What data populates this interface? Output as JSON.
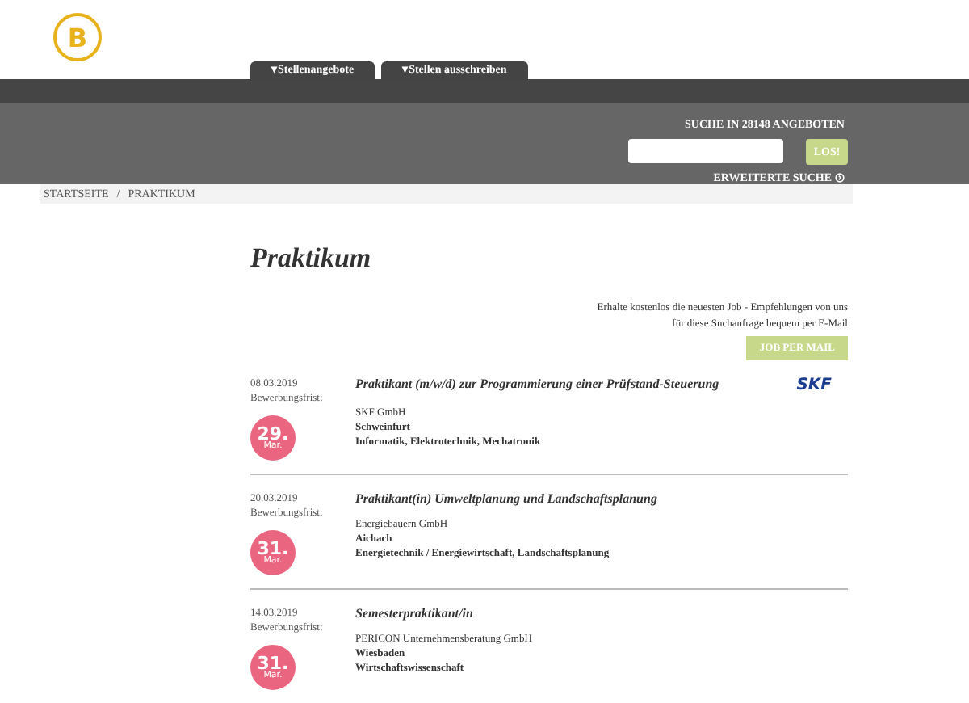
{
  "logo": {
    "letter": "B"
  },
  "nav_tabs": [
    {
      "label": "▾Stellenangebote"
    },
    {
      "label": "▾Stellen ausschreiben"
    }
  ],
  "search": {
    "label": "SUCHE IN 28148 ANGEBOTEN",
    "button": "LOS!",
    "advanced": "ERWEITERTE SUCHE"
  },
  "breadcrumb": {
    "items": [
      "STARTSEITE",
      "PRAKTIKUM"
    ],
    "separator": "/"
  },
  "page_title": "Praktikum",
  "mail_promo": {
    "text": "Erhalte kostenlos die neuesten Job - Empfehlungen von uns für diese Suchanfrage bequem per E-Mail",
    "button": "JOB PER MAIL"
  },
  "jobs": [
    {
      "date": "08.03.2019",
      "deadline_label": "Bewerbungsfrist:",
      "deadline_day": "29.",
      "deadline_month": "Mar.",
      "title": "Praktikant (m/w/d) zur Programmierung einer Prüfstand-Steuerung",
      "company": "SKF GmbH",
      "location": "Schweinfurt",
      "fields": "Informatik, Elektrotechnik, Mechatronik",
      "company_logo": "SKF"
    },
    {
      "date": "20.03.2019",
      "deadline_label": "Bewerbungsfrist:",
      "deadline_day": "31.",
      "deadline_month": "Mar.",
      "title": "Praktikant(in) Umweltplanung und Landschaftsplanung",
      "company": "Energiebauern GmbH",
      "location": "Aichach",
      "fields": "Energietechnik / Energiewirtschaft, Landschaftsplanung"
    },
    {
      "date": "14.03.2019",
      "deadline_label": "Bewerbungsfrist:",
      "deadline_day": "31.",
      "deadline_month": "Mar.",
      "title": "Semesterpraktikant/in",
      "company": "PERICON Unternehmensberatung GmbH",
      "location": "Wiesbaden",
      "fields": "Wirtschaftswissenschaft"
    }
  ]
}
